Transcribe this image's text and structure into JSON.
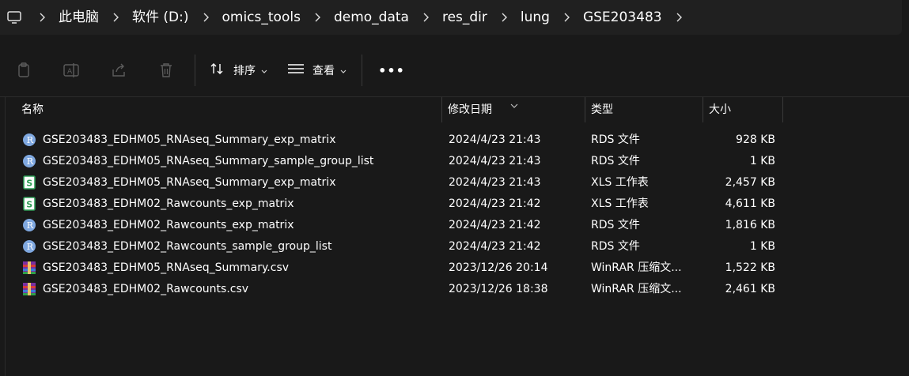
{
  "breadcrumb": {
    "items": [
      "此电脑",
      "软件 (D:)",
      "omics_tools",
      "demo_data",
      "res_dir",
      "lung",
      "GSE203483"
    ]
  },
  "toolbar": {
    "sort_label": "排序",
    "view_label": "查看",
    "more_label": "•••"
  },
  "columns": {
    "name": "名称",
    "date": "修改日期",
    "type": "类型",
    "size": "大小"
  },
  "files": [
    {
      "name": "GSE203483_EDHM05_RNAseq_Summary_exp_matrix",
      "date": "2024/4/23 21:43",
      "type": "RDS 文件",
      "size": "928 KB",
      "icon": "r-file-icon"
    },
    {
      "name": "GSE203483_EDHM05_RNAseq_Summary_sample_group_list",
      "date": "2024/4/23 21:43",
      "type": "RDS 文件",
      "size": "1 KB",
      "icon": "r-file-icon"
    },
    {
      "name": "GSE203483_EDHM05_RNAseq_Summary_exp_matrix",
      "date": "2024/4/23 21:43",
      "type": "XLS 工作表",
      "size": "2,457 KB",
      "icon": "spreadsheet-icon"
    },
    {
      "name": "GSE203483_EDHM02_Rawcounts_exp_matrix",
      "date": "2024/4/23 21:42",
      "type": "XLS 工作表",
      "size": "4,611 KB",
      "icon": "spreadsheet-icon"
    },
    {
      "name": "GSE203483_EDHM02_Rawcounts_exp_matrix",
      "date": "2024/4/23 21:42",
      "type": "RDS 文件",
      "size": "1,816 KB",
      "icon": "r-file-icon"
    },
    {
      "name": "GSE203483_EDHM02_Rawcounts_sample_group_list",
      "date": "2024/4/23 21:42",
      "type": "RDS 文件",
      "size": "1 KB",
      "icon": "r-file-icon"
    },
    {
      "name": "GSE203483_EDHM05_RNAseq_Summary.csv",
      "date": "2023/12/26 20:14",
      "type": "WinRAR 压缩文...",
      "size": "1,522 KB",
      "icon": "winrar-archive-icon"
    },
    {
      "name": "GSE203483_EDHM02_Rawcounts.csv",
      "date": "2023/12/26 18:38",
      "type": "WinRAR 压缩文...",
      "size": "2,461 KB",
      "icon": "winrar-archive-icon"
    }
  ],
  "colors": {
    "background": "#191919",
    "addressbar": "#202020",
    "text": "#ffffff",
    "r_icon": "#7fa8e0",
    "xls_icon": "#2f9e56"
  }
}
